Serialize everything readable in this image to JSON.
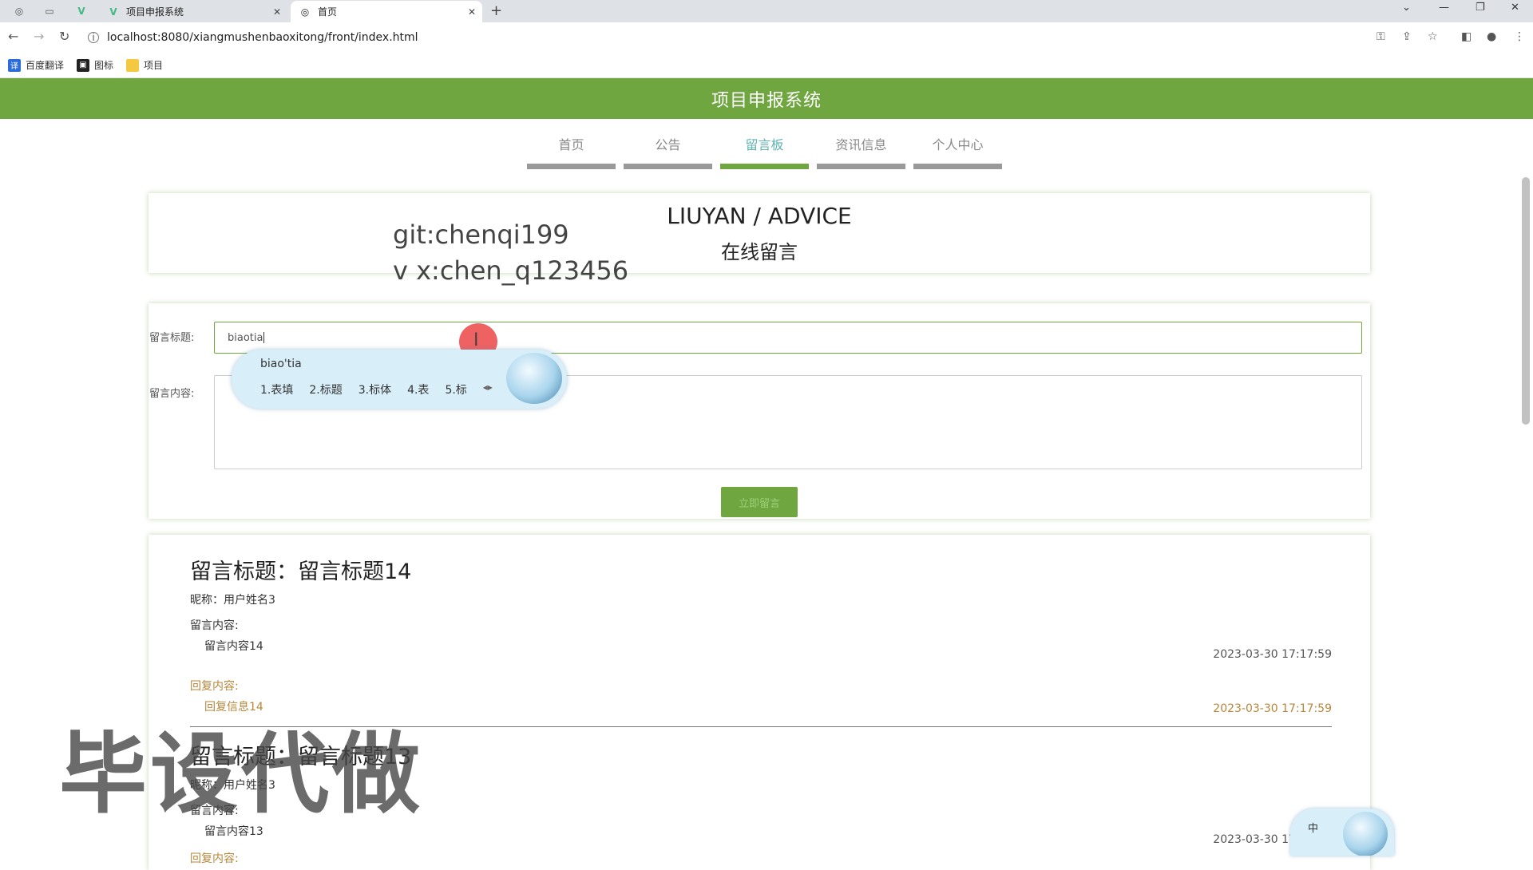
{
  "browser": {
    "tabs": [
      {
        "title": "项目申报系统",
        "active": false
      },
      {
        "title": "首页",
        "active": true
      }
    ],
    "url": "localhost:8080/xiangmushenbaoxitong/front/index.html",
    "bookmarks": [
      "百度翻译",
      "图标",
      "项目"
    ]
  },
  "site": {
    "title": "项目申报系统",
    "menu": [
      "首页",
      "公告",
      "留言板",
      "资讯信息",
      "个人中心"
    ],
    "active_menu": "留言板"
  },
  "section": {
    "title_en": "LIUYAN / ADVICE",
    "title_cn": "在线留言"
  },
  "overlay": {
    "line1": "git:chenqi199",
    "line2": "v x:chen_q123456",
    "watermark": "毕设代做"
  },
  "form": {
    "title_label": "留言标题:",
    "title_value": "biaotia",
    "content_label": "留言内容:",
    "submit_label": "立即留言"
  },
  "ime": {
    "pinyin": "biao'tia",
    "candidates": [
      "1.表填",
      "2.标题",
      "3.标体",
      "4.表",
      "5.标"
    ],
    "float_label": "中"
  },
  "messages": [
    {
      "title": "留言标题：留言标题14",
      "nickname": "昵称：用户姓名3",
      "content_label": "留言内容:",
      "content": "留言内容14",
      "time": "2023-03-30 17:17:59",
      "reply_label": "回复内容:",
      "reply": "回复信息14",
      "reply_time": "2023-03-30 17:17:59"
    },
    {
      "title": "留言标题：留言标题13",
      "nickname": "昵称：用户姓名3",
      "content_label": "留言内容:",
      "content": "留言内容13",
      "time": "2023-03-30 17:17:59",
      "reply_label": "回复内容:"
    }
  ],
  "colors": {
    "brand_green": "#6fa640",
    "active_menu_text": "#5fb3b3",
    "reply_text": "#b8863a"
  }
}
